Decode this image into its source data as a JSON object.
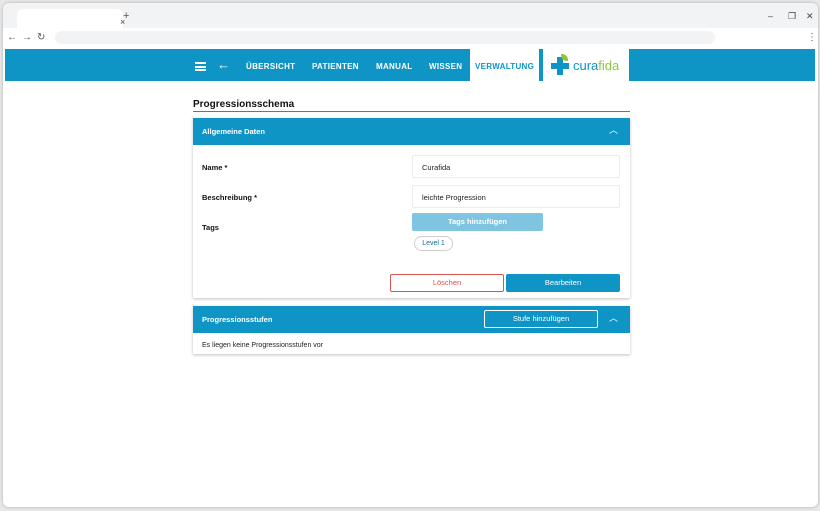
{
  "browser": {
    "tab_close": "×",
    "new_tab": "+",
    "minimize": "–",
    "restore": "❐",
    "close": "✕",
    "back": "←",
    "forward": "→",
    "reload": "↻",
    "menu": "⋮"
  },
  "appbar": {
    "nav": [
      "ÜBERSICHT",
      "PATIENTEN",
      "MANUAL",
      "WISSEN",
      "VERWALTUNG"
    ],
    "active_index": 4,
    "logo_text_a": "cura",
    "logo_text_b": "fida",
    "colors": {
      "primary": "#0e95c6",
      "accent": "#8cc63f"
    }
  },
  "page": {
    "title": "Progressionsschema"
  },
  "general": {
    "header": "Allgemeine Daten",
    "name_label": "Name *",
    "name_value": "Curafida",
    "description_label": "Beschreibung *",
    "description_value": "leichte Progression",
    "tags_label": "Tags",
    "tags_button": "Tags hinzufügen",
    "tags": [
      "Level 1"
    ],
    "delete_button": "Löschen",
    "edit_button": "Bearbeiten"
  },
  "stages": {
    "header": "Progressionsstufen",
    "add_button": "Stufe hinzufügen",
    "empty_text": "Es liegen keine Progressionsstufen vor"
  }
}
